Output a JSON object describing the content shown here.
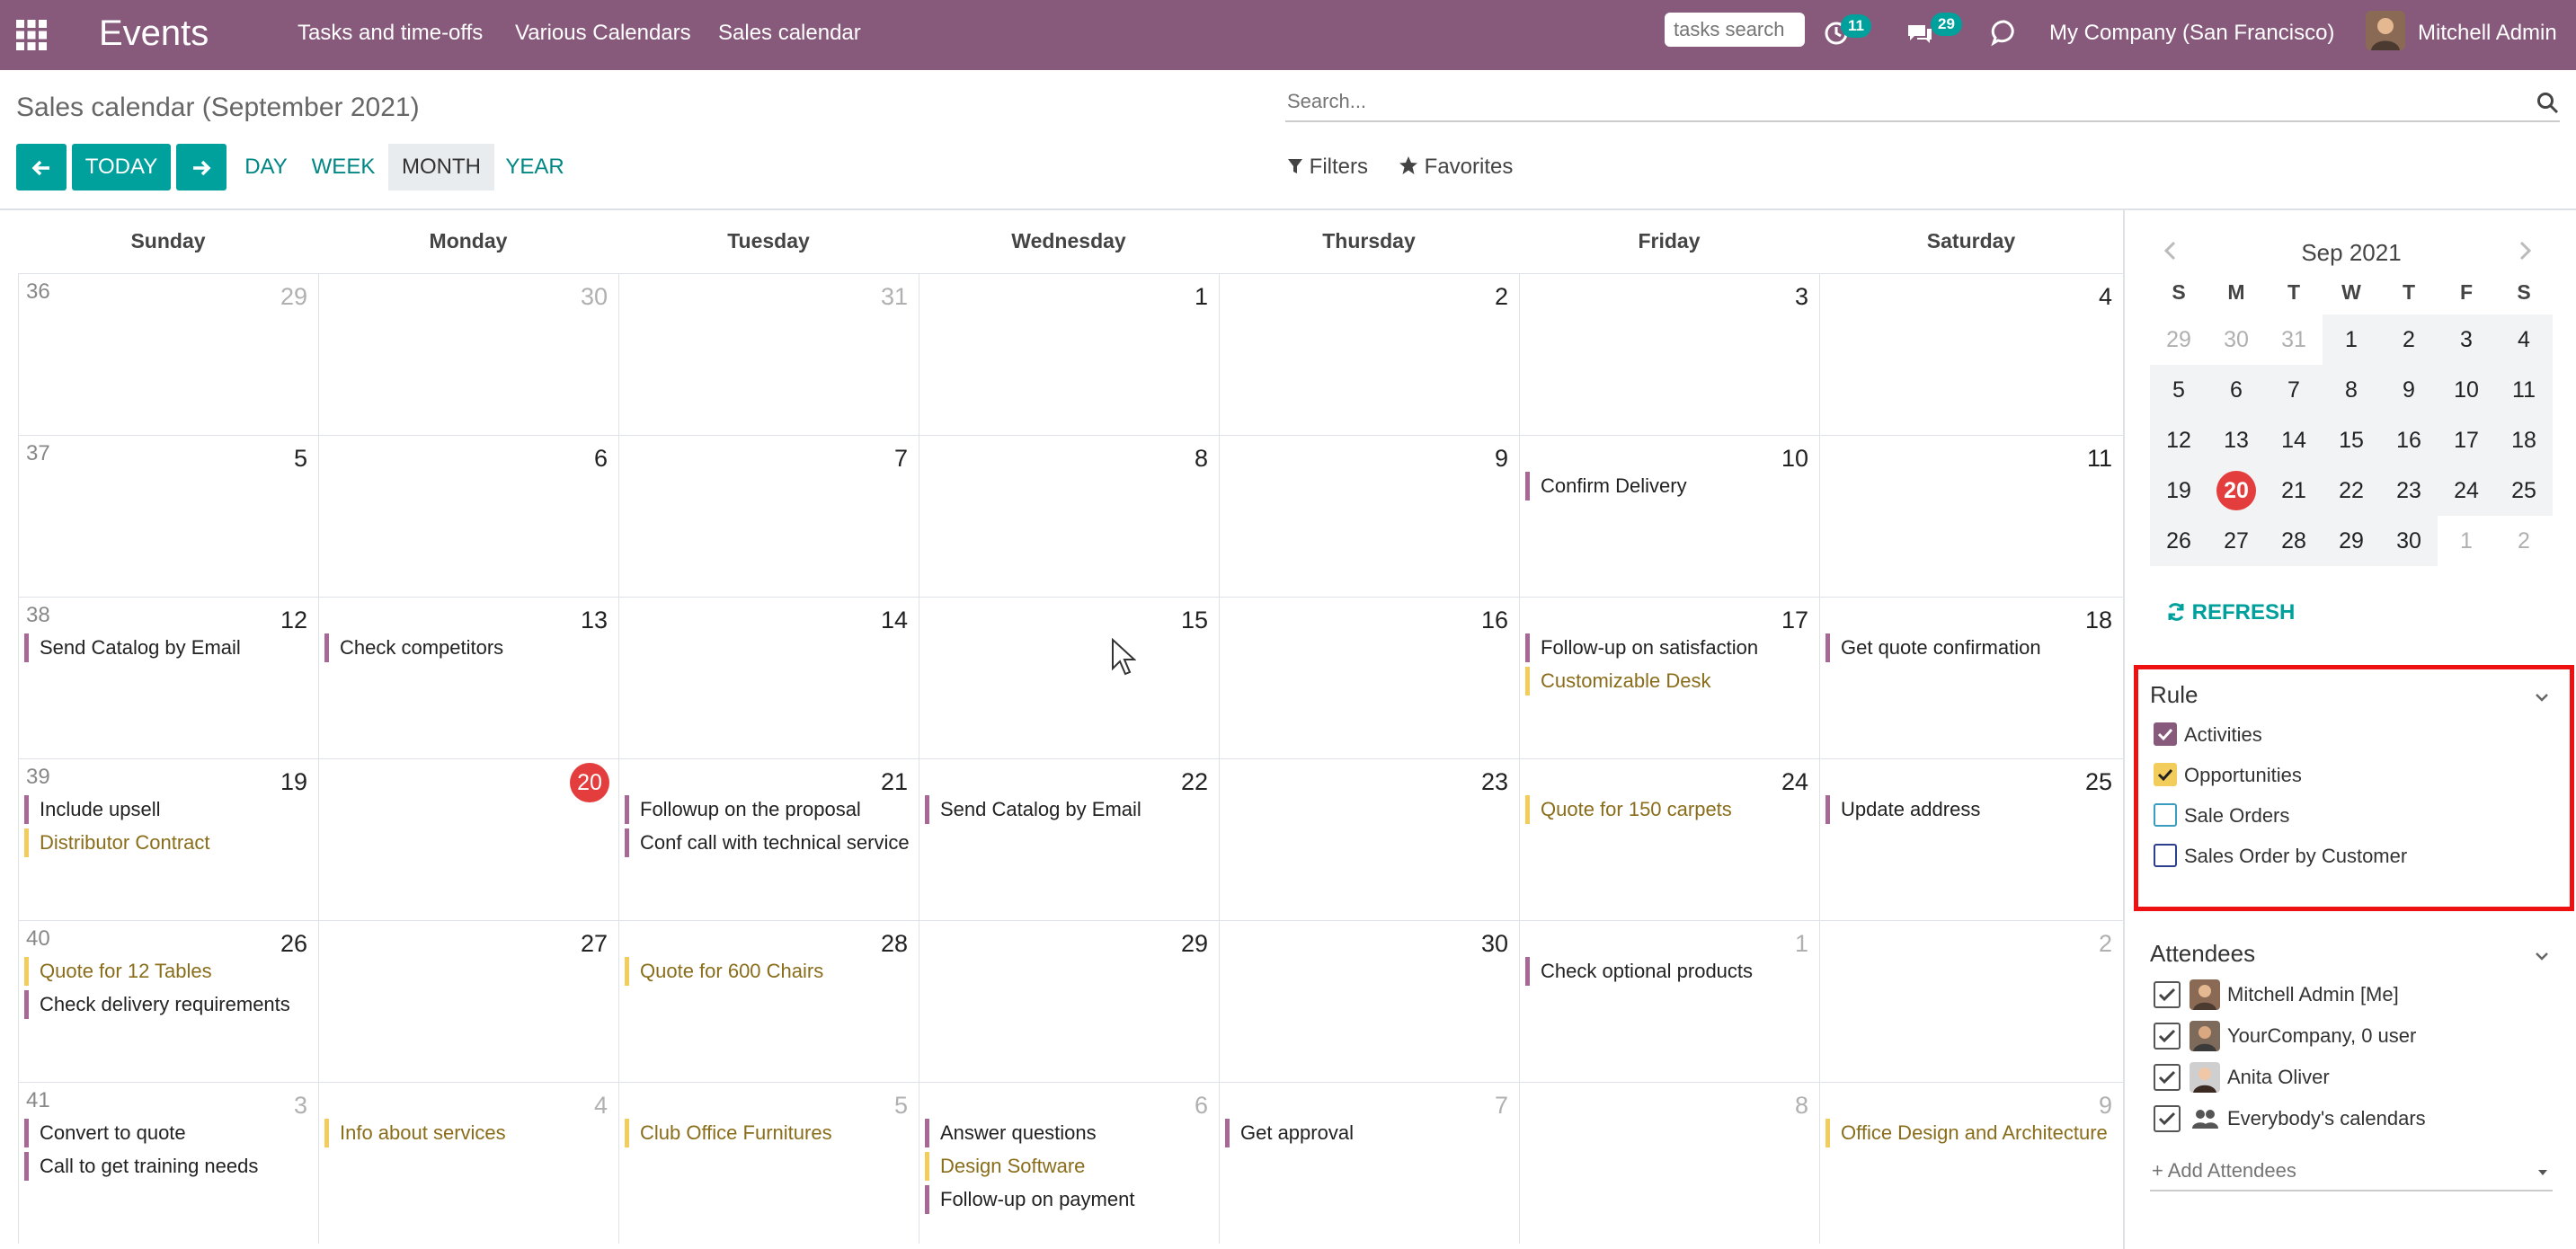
{
  "navbar": {
    "app_title": "Events",
    "menu": [
      "Tasks and time-offs",
      "Various Calendars",
      "Sales calendar"
    ],
    "tasks_search_placeholder": "tasks search",
    "activity_badge": "11",
    "messages_badge": "29",
    "company": "My Company (San Francisco)",
    "user": "Mitchell Admin",
    "bg_color": "#875a7b"
  },
  "control": {
    "breadcrumb": "Sales calendar (September 2021)",
    "search_placeholder": "Search...",
    "today_label": "TODAY",
    "scales": [
      "DAY",
      "WEEK",
      "MONTH",
      "YEAR"
    ],
    "active_scale": "MONTH",
    "filters_label": "Filters",
    "favorites_label": "Favorites"
  },
  "calendar": {
    "days": [
      "Sunday",
      "Monday",
      "Tuesday",
      "Wednesday",
      "Thursday",
      "Friday",
      "Saturday"
    ],
    "weeks": [
      {
        "num": "36",
        "days": [
          {
            "d": "29",
            "other": true,
            "events": []
          },
          {
            "d": "30",
            "other": true,
            "events": []
          },
          {
            "d": "31",
            "other": true,
            "events": []
          },
          {
            "d": "1",
            "events": []
          },
          {
            "d": "2",
            "events": []
          },
          {
            "d": "3",
            "events": []
          },
          {
            "d": "4",
            "events": []
          }
        ]
      },
      {
        "num": "37",
        "days": [
          {
            "d": "5",
            "events": []
          },
          {
            "d": "6",
            "events": []
          },
          {
            "d": "7",
            "events": []
          },
          {
            "d": "8",
            "events": []
          },
          {
            "d": "9",
            "events": []
          },
          {
            "d": "10",
            "events": [
              {
                "t": "Confirm Delivery",
                "c": "purple"
              }
            ]
          },
          {
            "d": "11",
            "events": []
          }
        ]
      },
      {
        "num": "38",
        "days": [
          {
            "d": "12",
            "events": [
              {
                "t": "Send Catalog by Email",
                "c": "purple"
              }
            ]
          },
          {
            "d": "13",
            "events": [
              {
                "t": "Check competitors",
                "c": "purple"
              }
            ]
          },
          {
            "d": "14",
            "events": []
          },
          {
            "d": "15",
            "events": []
          },
          {
            "d": "16",
            "events": []
          },
          {
            "d": "17",
            "events": [
              {
                "t": "Follow-up on satisfaction",
                "c": "purple"
              },
              {
                "t": "Customizable Desk",
                "c": "yellow"
              }
            ]
          },
          {
            "d": "18",
            "events": [
              {
                "t": "Get quote confirmation",
                "c": "purple"
              }
            ]
          }
        ]
      },
      {
        "num": "39",
        "days": [
          {
            "d": "19",
            "events": [
              {
                "t": "Include upsell",
                "c": "purple"
              },
              {
                "t": "Distributor Contract",
                "c": "yellow"
              }
            ]
          },
          {
            "d": "20",
            "today": true,
            "events": []
          },
          {
            "d": "21",
            "events": [
              {
                "t": "Followup on the proposal",
                "c": "purple"
              },
              {
                "t": "Conf call with technical service",
                "c": "purple"
              }
            ]
          },
          {
            "d": "22",
            "events": [
              {
                "t": "Send Catalog by Email",
                "c": "purple"
              }
            ]
          },
          {
            "d": "23",
            "events": []
          },
          {
            "d": "24",
            "events": [
              {
                "t": "Quote for 150 carpets",
                "c": "yellow"
              }
            ]
          },
          {
            "d": "25",
            "events": [
              {
                "t": "Update address",
                "c": "purple"
              }
            ]
          }
        ]
      },
      {
        "num": "40",
        "days": [
          {
            "d": "26",
            "events": [
              {
                "t": "Quote for 12 Tables",
                "c": "yellow"
              },
              {
                "t": "Check delivery requirements",
                "c": "purple"
              }
            ]
          },
          {
            "d": "27",
            "events": []
          },
          {
            "d": "28",
            "events": [
              {
                "t": "Quote for 600 Chairs",
                "c": "yellow"
              }
            ]
          },
          {
            "d": "29",
            "events": []
          },
          {
            "d": "30",
            "events": []
          },
          {
            "d": "1",
            "other": true,
            "events": [
              {
                "t": "Check optional products",
                "c": "purple"
              }
            ]
          },
          {
            "d": "2",
            "other": true,
            "events": []
          }
        ]
      },
      {
        "num": "41",
        "days": [
          {
            "d": "3",
            "other": true,
            "events": [
              {
                "t": "Convert to quote",
                "c": "purple"
              },
              {
                "t": "Call to get training needs",
                "c": "purple"
              }
            ]
          },
          {
            "d": "4",
            "other": true,
            "events": [
              {
                "t": "Info about services",
                "c": "yellow"
              }
            ]
          },
          {
            "d": "5",
            "other": true,
            "events": [
              {
                "t": "Club Office Furnitures",
                "c": "yellow"
              }
            ]
          },
          {
            "d": "6",
            "other": true,
            "events": [
              {
                "t": "Answer questions",
                "c": "purple"
              },
              {
                "t": "Design Software",
                "c": "yellow"
              },
              {
                "t": "Follow-up on payment",
                "c": "purple"
              }
            ]
          },
          {
            "d": "7",
            "other": true,
            "events": [
              {
                "t": "Get approval",
                "c": "purple"
              }
            ]
          },
          {
            "d": "8",
            "other": true,
            "events": []
          },
          {
            "d": "9",
            "other": true,
            "events": [
              {
                "t": "Office Design and Architecture",
                "c": "yellow"
              }
            ]
          }
        ]
      }
    ]
  },
  "sidebar": {
    "mini_title": "Sep 2021",
    "dow": [
      "S",
      "M",
      "T",
      "W",
      "T",
      "F",
      "S"
    ],
    "mini_weeks": [
      [
        [
          "29",
          1
        ],
        [
          "30",
          1
        ],
        [
          "31",
          1
        ],
        [
          "1",
          0
        ],
        [
          "2",
          0
        ],
        [
          "3",
          0
        ],
        [
          "4",
          0
        ]
      ],
      [
        [
          "5",
          0
        ],
        [
          "6",
          0
        ],
        [
          "7",
          0
        ],
        [
          "8",
          0
        ],
        [
          "9",
          0
        ],
        [
          "10",
          0
        ],
        [
          "11",
          0
        ]
      ],
      [
        [
          "12",
          0
        ],
        [
          "13",
          0
        ],
        [
          "14",
          0
        ],
        [
          "15",
          0
        ],
        [
          "16",
          0
        ],
        [
          "17",
          0
        ],
        [
          "18",
          0
        ]
      ],
      [
        [
          "19",
          0
        ],
        [
          "20",
          2
        ],
        [
          "21",
          0
        ],
        [
          "22",
          0
        ],
        [
          "23",
          0
        ],
        [
          "24",
          0
        ],
        [
          "25",
          0
        ]
      ],
      [
        [
          "26",
          0
        ],
        [
          "27",
          0
        ],
        [
          "28",
          0
        ],
        [
          "29",
          0
        ],
        [
          "30",
          0
        ],
        [
          "1",
          1
        ],
        [
          "2",
          1
        ]
      ]
    ],
    "refresh_label": "REFRESH",
    "rule_title": "Rule",
    "rules": [
      {
        "label": "Activities",
        "checked": true,
        "color": "#875a7b"
      },
      {
        "label": "Opportunities",
        "checked": true,
        "color": "#f3cd5c"
      },
      {
        "label": "Sale Orders",
        "checked": false,
        "color": "#3a9dbf"
      },
      {
        "label": "Sales Order by Customer",
        "checked": false,
        "color": "#2c3e8c"
      }
    ],
    "attendees_title": "Attendees",
    "attendees": [
      {
        "label": "Mitchell Admin [Me]",
        "icon": "avatar"
      },
      {
        "label": "YourCompany, 0 user",
        "icon": "avatar"
      },
      {
        "label": "Anita Oliver",
        "icon": "avatar"
      },
      {
        "label": "Everybody's calendars",
        "icon": "users-icon"
      }
    ],
    "add_attendees_placeholder": "+ Add Attendees"
  }
}
